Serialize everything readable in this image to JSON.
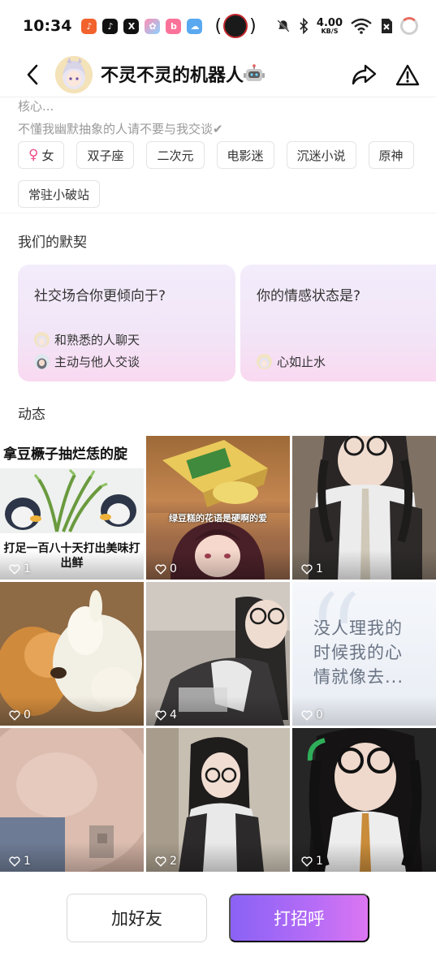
{
  "status_bar": {
    "time": "10:34",
    "net_speed": "4.00",
    "net_unit": "KB/S",
    "wifi_label": "6",
    "app_icons": [
      "douyin-lite-icon",
      "tiktok-icon",
      "x-icon",
      "app-icon",
      "bilibili-icon",
      "weather-icon"
    ]
  },
  "header": {
    "title": "不灵不灵的机器人",
    "title_emoji": "🤖"
  },
  "profile": {
    "bio_line1": "核心...",
    "bio_line2": "不懂我幽默抽象的人请不要与我交谈✔",
    "gender_symbol": "♀",
    "gender_label": "女",
    "tags": [
      "双子座",
      "二次元",
      "电影迷",
      "沉迷小说",
      "原神",
      "常驻小破站"
    ]
  },
  "tacit": {
    "title": "我们的默契",
    "cards": [
      {
        "question": "社交场合你更倾向于?",
        "answers": [
          "和熟悉的人聊天",
          "主动与他人交谈"
        ]
      },
      {
        "question": "你的情感状态是?",
        "answers": [
          "心如止水"
        ]
      }
    ]
  },
  "moments": {
    "title": "动态",
    "posts": [
      {
        "caption_top": "拿豆橛子抽烂恁的腚",
        "caption_bottom": "打足一百八十天打出美味打出鲜",
        "likes": "1"
      },
      {
        "caption": "绿豆糕的花语是硬啊的爱",
        "likes": "0"
      },
      {
        "likes": "1"
      },
      {
        "likes": "0"
      },
      {
        "likes": "4"
      },
      {
        "text": "没人理我的时候我的心情就像去...",
        "likes": "0"
      },
      {
        "likes": "1"
      },
      {
        "likes": "2"
      },
      {
        "likes": "1"
      }
    ]
  },
  "actions": {
    "add_friend": "加好友",
    "greet": "打招呼"
  },
  "colors": {
    "accent_start": "#8a62f5",
    "accent_end": "#dc76f2",
    "gender_pink": "#ef4f8a"
  }
}
